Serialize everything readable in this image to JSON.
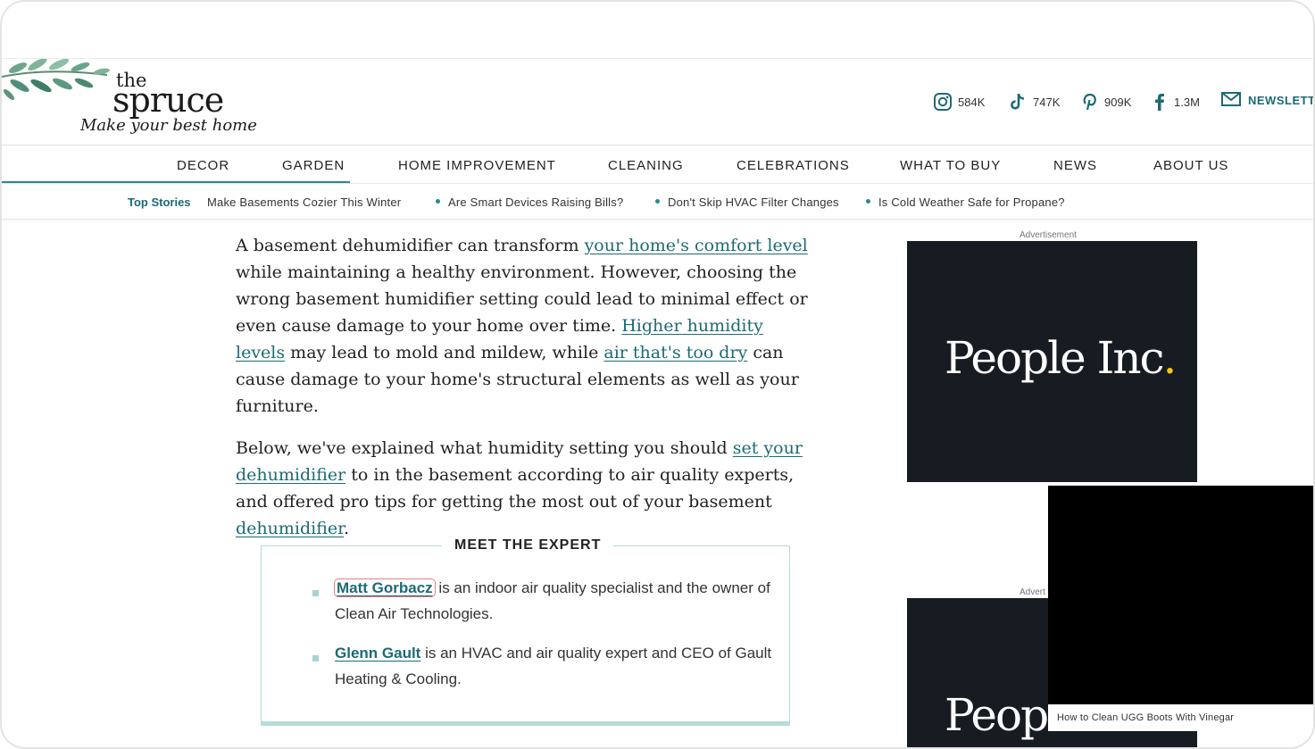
{
  "logo": {
    "line1": "the",
    "line2": "spruce",
    "tagline": "Make your best home"
  },
  "social": [
    {
      "icon": "instagram-icon",
      "count": "584K"
    },
    {
      "icon": "tiktok-icon",
      "count": "747K"
    },
    {
      "icon": "pinterest-icon",
      "count": "909K"
    },
    {
      "icon": "facebook-icon",
      "count": "1.3M"
    }
  ],
  "newsletter_label": "NEWSLETT",
  "nav": [
    "DECOR",
    "GARDEN",
    "HOME IMPROVEMENT",
    "CLEANING",
    "CELEBRATIONS",
    "WHAT TO BUY",
    "NEWS",
    "ABOUT US"
  ],
  "top_stories": {
    "label": "Top Stories",
    "items": [
      "Make Basements Cozier This Winter",
      "Are Smart Devices Raising Bills?",
      "Don't Skip HVAC Filter Changes",
      "Is Cold Weather Safe for Propane?"
    ]
  },
  "article": {
    "p1_a": "A basement dehumidifier can transform ",
    "p1_link1": "your home's comfort level",
    "p1_b": " while maintaining a healthy environment. However, choosing the wrong basement humidifier setting could lead to minimal effect or even cause damage to your home over time. ",
    "p1_link2": "Higher humidity levels",
    "p1_c": " may lead to mold and mildew, while ",
    "p1_link3": "air that's too dry",
    "p1_d": " can cause damage to your home's structural elements as well as your furniture.",
    "p2_a": "Below, we've explained what humidity setting you should ",
    "p2_link1": "set your dehumidifier",
    "p2_b": " to in the basement according to air quality experts, and offered pro tips for getting the most out of your basement ",
    "p2_link2": "dehumidifier",
    "p2_c": "."
  },
  "expert": {
    "title": "MEET THE EXPERT",
    "items": [
      {
        "name": "Matt Gorbacz",
        "desc": " is an indoor air quality specialist and the owner of Clean Air Technologies."
      },
      {
        "name": "Glenn Gault",
        "desc": " is an HVAC and air quality expert and CEO of Gault Heating & Cooling."
      }
    ]
  },
  "ads": {
    "label1": "Advertisement",
    "text1": "People Inc",
    "dot1": ".",
    "label2": "Advert",
    "text2": "Peopl"
  },
  "video": {
    "caption": "How to Clean UGG Boots With Vinegar"
  },
  "colors": {
    "accent": "#1c6a75",
    "teal_line": "#2b8a8c",
    "ad_bg": "#171b22",
    "ad_dot": "#f3c41a"
  }
}
